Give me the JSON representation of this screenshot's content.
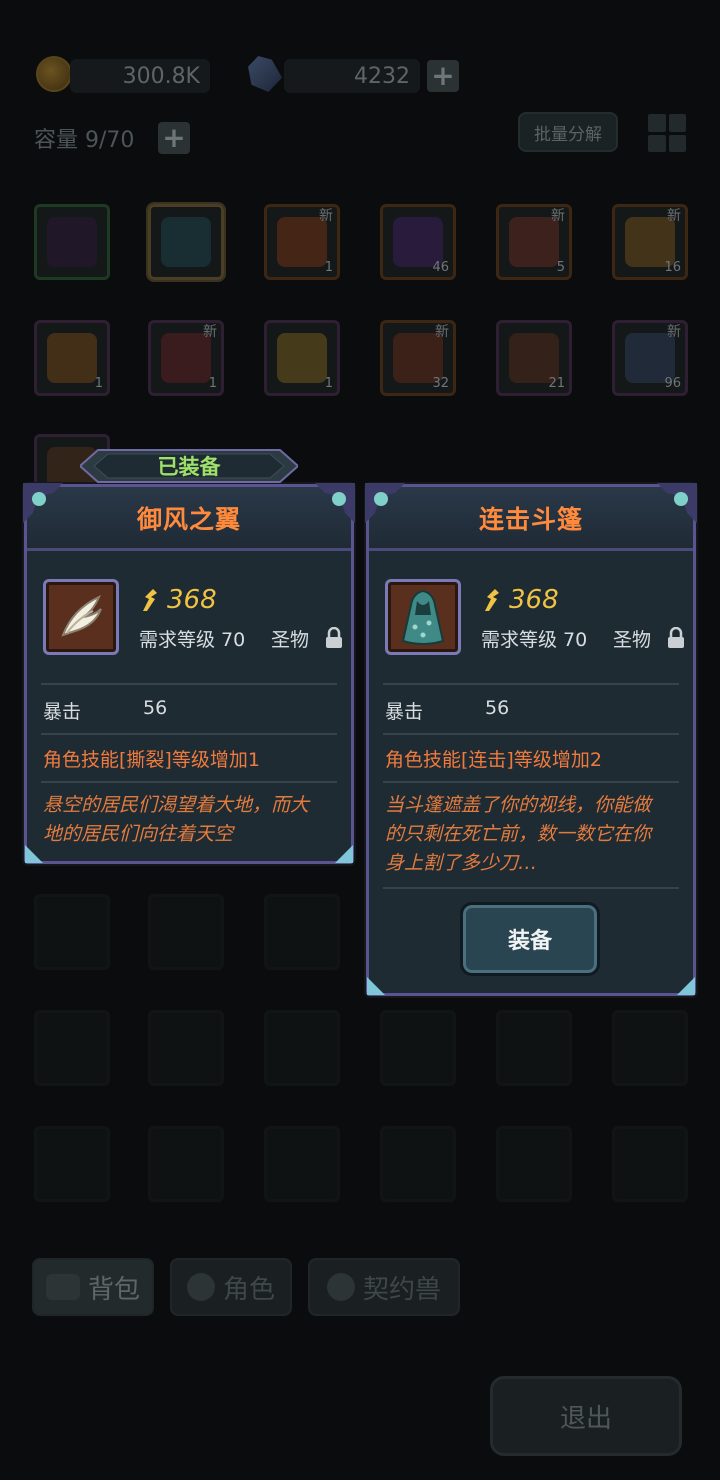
{
  "currency": {
    "gold": "300.8K",
    "gems": "4232"
  },
  "inventory": {
    "capacity_label": "容量 9/70",
    "bulk_salvage_label": "批量分解",
    "new_tag": "新",
    "row1": [
      {
        "name": "dark-cape-item",
        "count": "",
        "is_new": false,
        "art": "#2a1a35"
      },
      {
        "name": "cloak-item-selected",
        "count": "",
        "is_new": false,
        "art": "#1d4248"
      },
      {
        "name": "fire-spirit-item",
        "count": "1",
        "is_new": true,
        "art": "#6b3214"
      },
      {
        "name": "purple-crystal-item",
        "count": "46",
        "is_new": false,
        "art": "#3b1f57"
      },
      {
        "name": "meat-steak-item",
        "count": "5",
        "is_new": true,
        "art": "#5c2a20"
      },
      {
        "name": "star-shard-item",
        "count": "16",
        "is_new": true,
        "art": "#6a4a1a"
      }
    ],
    "row2": [
      {
        "name": "bread-item",
        "count": "1",
        "is_new": false,
        "art": "#6a4418"
      },
      {
        "name": "raw-meat-item",
        "count": "1",
        "is_new": true,
        "art": "#5a1f22"
      },
      {
        "name": "cheese-item",
        "count": "1",
        "is_new": false,
        "art": "#6d5a1c"
      },
      {
        "name": "drumstick-item",
        "count": "32",
        "is_new": true,
        "art": "#5c2a1a"
      },
      {
        "name": "amulet-item",
        "count": "21",
        "is_new": false,
        "art": "#4f2a1a"
      },
      {
        "name": "cloth-item",
        "count": "96",
        "is_new": true,
        "art": "#2a3b52"
      }
    ]
  },
  "equipped_card": {
    "banner": "已装备",
    "title": "御风之翼",
    "power": "368",
    "level_req": "需求等级 70",
    "rarity": "圣物",
    "stat_name": "暴击",
    "stat_value": "56",
    "skill_bonus": "角色技能[撕裂]等级增加1",
    "lore_line1": "悬空的居民们渴望着大地，而大",
    "lore_line2": "地的居民们向往着天空"
  },
  "new_card": {
    "title": "连击斗篷",
    "power": "368",
    "level_req": "需求等级 70",
    "rarity": "圣物",
    "stat_name": "暴击",
    "stat_value": "56",
    "skill_bonus": "角色技能[连击]等级增加2",
    "lore_line1": "当斗篷遮盖了你的视线，你能做",
    "lore_line2": "的只剩在死亡前，数一数它在你",
    "lore_line3": "身上割了多少刀…",
    "equip_button": "装备"
  },
  "tabs": {
    "backpack": "背包",
    "character": "角色",
    "pet": "契约兽"
  },
  "exit_button": "退出",
  "colors": {
    "title_orange": "#ff8a3c",
    "power_gold": "#f0c343",
    "equipped_green": "#9fe06b",
    "card_border": "#5a5590"
  }
}
